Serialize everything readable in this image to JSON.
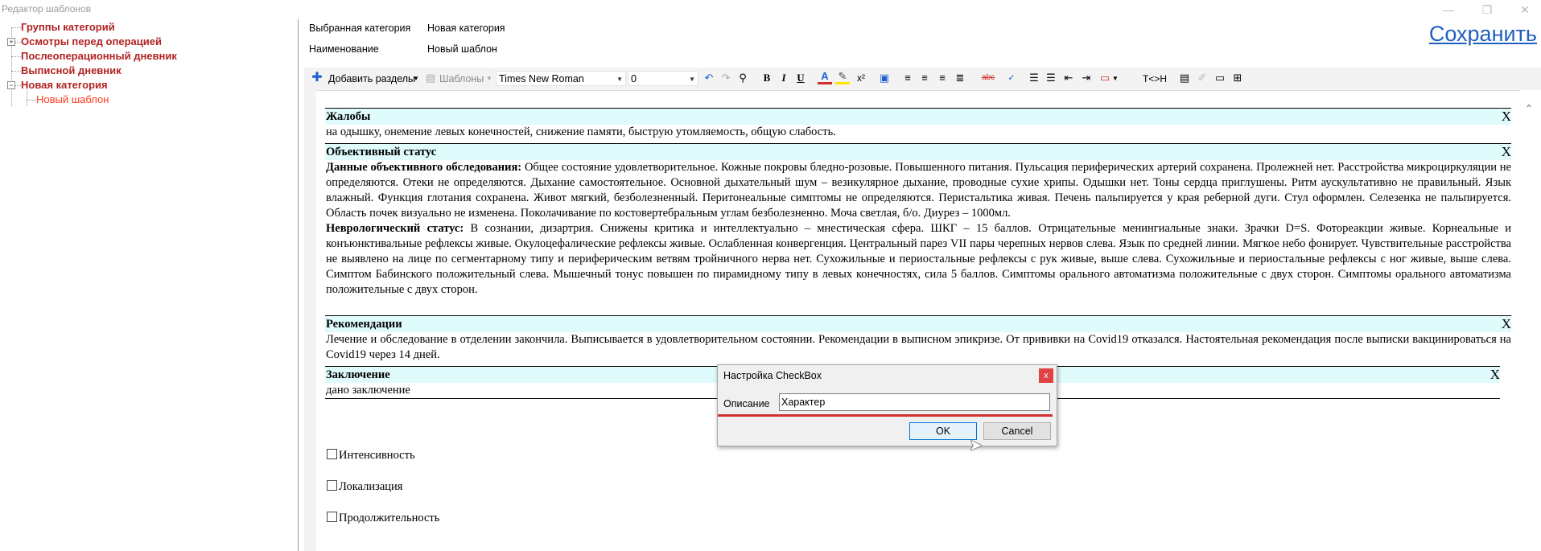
{
  "window": {
    "title": "Редактор шаблонов",
    "controls": [
      "—",
      "❐",
      "✕"
    ]
  },
  "tree": {
    "items": [
      {
        "label": "Группы категорий"
      },
      {
        "label": "Осмотры перед операцией"
      },
      {
        "label": "Послеоперационный дневник"
      },
      {
        "label": "Выписной дневник"
      },
      {
        "label": "Новая категория"
      },
      {
        "label": "Новый шаблон"
      }
    ],
    "expander_plus": "+",
    "expander_minus": "−"
  },
  "info": {
    "category_label": "Выбранная категория",
    "category_value": "Новая категория",
    "name_label": "Наименование",
    "name_value": "Новый шаблон"
  },
  "save_label": "Сохранить",
  "toolbar": {
    "add_sections": "Добавить разделы",
    "templates": "Шаблоны",
    "font_name": "Times New Roman",
    "font_size": "0",
    "t_to_h": "T<>H"
  },
  "sections": [
    {
      "title": "Жалобы",
      "close": "X",
      "body": "на одышку, онемение левых конечностей, снижение памяти, быструю утомляемость, общую слабость."
    },
    {
      "title": "Объективный статус",
      "close": "X",
      "p1_lead": "Данные объективного обследования:",
      "p1_text": " Общее состояние удовлетворительное. Кожные покровы бледно-розовые. Повышенного питания. Пульсация периферических артерий сохранена. Пролежней нет. Расстройства микроциркуляции не определяются. Отеки не определяются. Дыхание самостоятельное. Основной дыхательный шум – везикулярное дыхание, проводные сухие хрипы. Одышки нет. Тоны сердца приглушены. Ритм аускультативно не правильный. Язык влажный. Функция глотания сохранена. Живот мягкий, безболезненный. Перитонеальные симптомы не определяются. Перистальтика живая. Печень пальпируется у края реберной дуги. Стул оформлен. Селезенка не пальпируется. Область почек визуально не изменена. Поколачивание по костовертебральным углам безболезненно. Моча светлая, б/о. Диурез – 1000мл.",
      "p2_lead": "Неврологический статус:",
      "p2_text": " В сознании, дизартрия. Снижены критика и интеллектуально – мнестическая сфера. ШКГ – 15 баллов. Отрицательные менингиальные знаки. Зрачки D=S. Фотореакции живые. Корнеальные и конъюнктивальные рефлексы живые. Окулоцефалические рефлексы живые. Ослабленная конвергенция. Центральный парез VII пары черепных нервов слева. Язык по средней линии. Мягкое небо фонирует. Чувствительные расстройства не выявлено на лице по сегментарному типу и периферическим ветвям тройничного нерва нет. Сухожильные и периостальные рефлексы с рук живые, выше слева. Сухожильные и периостальные рефлексы с ног живые, выше слева. Симптом Бабинского положительный слева. Мышечный тонус повышен по пирамидному типу в левых конечностях, сила 5 баллов. Симптомы орального автоматизма положительные с двух сторон. Симптомы орального автоматизма положительные с двух сторон."
    },
    {
      "title": "Рекомендации",
      "close": "X",
      "body": "Лечение и обследование в отделении закончила. Выписывается в удовлетворительном  состоянии. Рекомендации в выписном эпикризе. От прививки  на Covid19 отказался. Настоятельная рекомендация после выписки вакцинироваться на Covid19 через 14 дней."
    },
    {
      "title": "Заключение",
      "close": "X",
      "body": "дано заключение"
    }
  ],
  "checkboxes": [
    {
      "label": "Интенсивность",
      "checked": false
    },
    {
      "label": "Локализация",
      "checked": false
    },
    {
      "label": "Продолжительность",
      "checked": false
    }
  ],
  "dialog": {
    "title": "Настройка CheckBox",
    "close": "x",
    "field_label": "Описание",
    "field_value": "Характер",
    "ok": "OK",
    "cancel": "Cancel"
  },
  "colors": {
    "section_header_bg": "#e0fbfc",
    "tree_category": "#b22222",
    "tree_template": "#ff3b1a",
    "save_link": "#1f5fbf",
    "dialog_close": "#e04343",
    "highlight_line": "#d32f2f"
  }
}
